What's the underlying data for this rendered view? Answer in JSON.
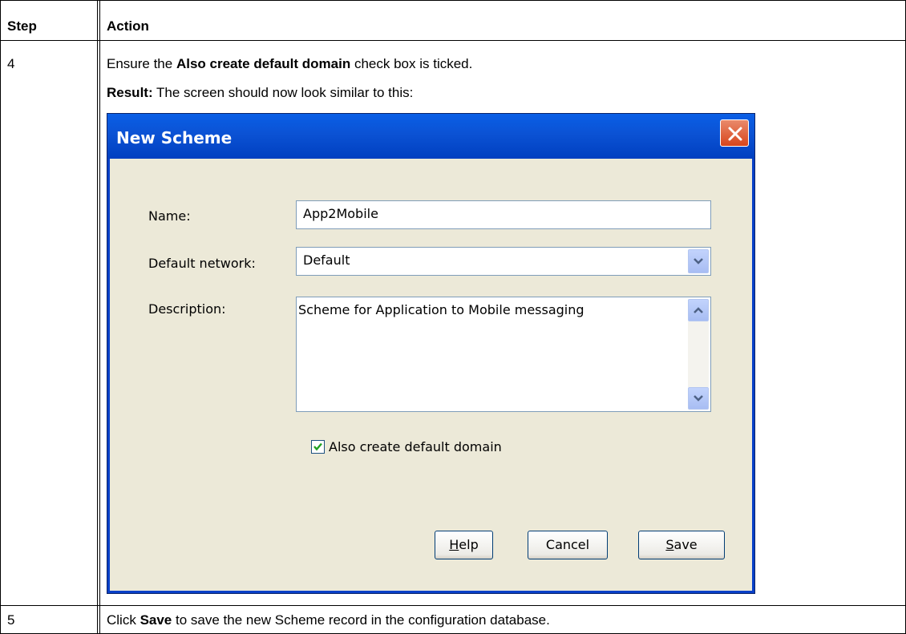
{
  "table": {
    "header": {
      "step": "Step",
      "action": "Action"
    },
    "rows": [
      {
        "step": "4",
        "line1_before": "Ensure the ",
        "line1_bold": "Also create default domain",
        "line1_after": " check box is ticked.",
        "result_label": "Result:",
        "result_text": " The screen should now look similar to this:"
      },
      {
        "step": "5",
        "line_before": "Click ",
        "line_bold": "Save",
        "line_after": " to save the new Scheme record in the configuration database."
      }
    ]
  },
  "dialog": {
    "title": "New Scheme",
    "name_label": "Name:",
    "name_value": "App2Mobile",
    "network_label": "Default network:",
    "network_value": "Default",
    "description_label": "Description:",
    "description_value": "Scheme for Application to Mobile messaging",
    "checkbox_label": "Also create default domain",
    "checkbox_checked": true,
    "buttons": {
      "help_mnemonic": "H",
      "help_rest": "elp",
      "cancel": "Cancel",
      "save_mnemonic": "S",
      "save_rest": "ave"
    }
  },
  "icons": {
    "close": "close-icon",
    "dropdown": "chevron-down-icon",
    "scroll_up": "chevron-up-icon",
    "scroll_down": "chevron-down-icon",
    "check": "check-icon"
  },
  "colors": {
    "titlebar": "#0b52d4",
    "close_button": "#d8451c",
    "dialog_face": "#ece9d8",
    "field_border": "#7f9db9"
  }
}
